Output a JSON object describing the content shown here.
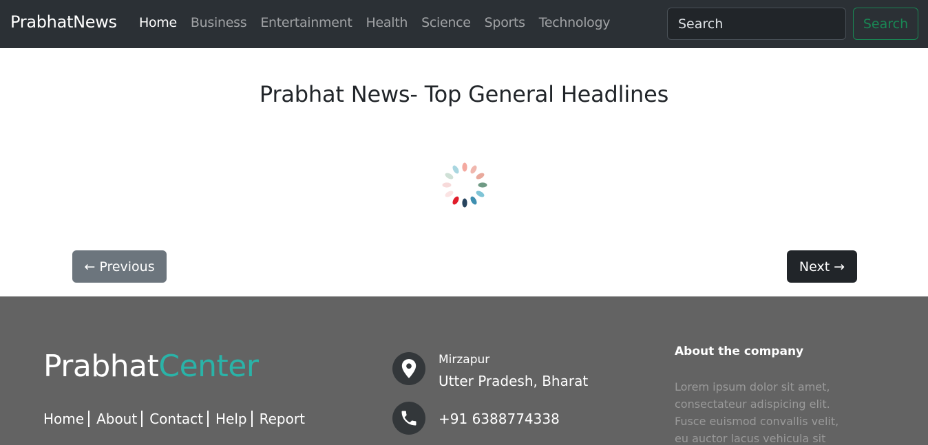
{
  "navbar": {
    "brand": "PrabhatNews",
    "links": [
      "Home",
      "Business",
      "Entertainment",
      "Health",
      "Science",
      "Sports",
      "Technology"
    ],
    "active_index": 0,
    "search_placeholder": "Search",
    "search_button": "Search"
  },
  "main": {
    "title": "Prabhat News- Top General Headlines",
    "prev_label": "← Previous",
    "next_label": "Next →"
  },
  "footer": {
    "logo_part1": "Prabhat",
    "logo_part2": "Center",
    "links": [
      "Home",
      "About",
      "Contact",
      "Help",
      "Report"
    ],
    "city": "Mirzapur",
    "state": "Utter Pradesh, Bharat",
    "phone": "+91 6388774338",
    "about_title": "About the company",
    "about_text": "Lorem ipsum dolor sit amet, consectateur adispicing elit. Fusce euismod convallis velit, eu auctor lacus vehicula sit"
  },
  "colors": {
    "navbar_bg": "#2b3035",
    "footer_bg": "#636363",
    "logo_accent": "#2ab3a8",
    "search_button": "#198754",
    "prev_button": "#6c757d",
    "next_button": "#212529"
  },
  "icons": {
    "location": "location-pin-icon",
    "phone": "phone-icon",
    "spinner": "loading-spinner-icon"
  }
}
